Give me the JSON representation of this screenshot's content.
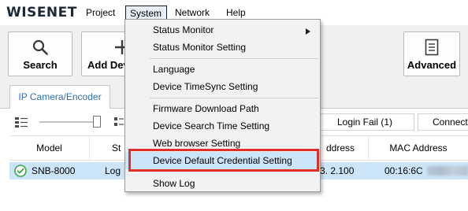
{
  "menubar": {
    "logo": "WISENET",
    "items": [
      "Project",
      "System",
      "Network",
      "Help"
    ]
  },
  "toolbar": {
    "search_label": "Search",
    "add_label": "Add Dev",
    "advanced_label": "Advanced"
  },
  "tab": {
    "label": "IP Camera/Encoder"
  },
  "status": {
    "login_fail": "Login Fail (1)",
    "connect": "Connect"
  },
  "table": {
    "headers": [
      "Model",
      "St",
      "ddress",
      "MAC Address"
    ],
    "rows": [
      {
        "model": "SNB-8000",
        "status": "Log",
        "ip": "3. 2.100",
        "mac": "00:16:6C"
      }
    ]
  },
  "dropdown": {
    "items": [
      "Status Monitor",
      "Status Monitor Setting",
      "Language",
      "Device TimeSync Setting",
      "Firmware Download Path",
      "Device Search Time Setting",
      "Web browser Setting",
      "Device Default Credential Setting",
      "Show Log"
    ]
  },
  "colors": {
    "highlight": "#e0302a",
    "selection": "#cce4f7",
    "tab_text": "#2b6fb5",
    "ok_green": "#3aa848"
  },
  "icons": {
    "search": "magnifier-icon",
    "add": "plus-icon",
    "advanced": "document-icon",
    "status_ok": "check-circle-icon",
    "submenu": "chevron-right-icon"
  }
}
